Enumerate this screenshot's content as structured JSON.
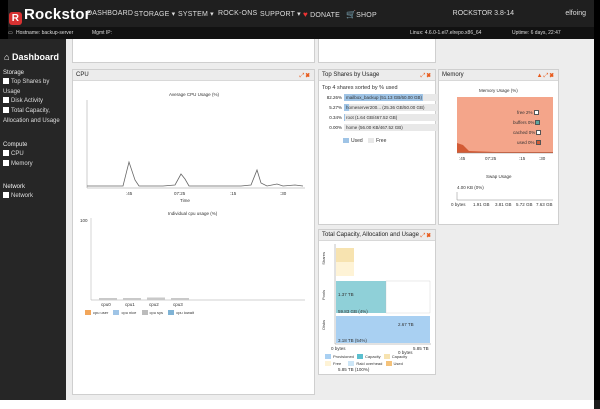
{
  "app": {
    "name": "Rockstor",
    "logo_letter": "R",
    "version": "ROCKSTOR 3.8-14",
    "user": "elfoing"
  },
  "nav": {
    "items": [
      "DASHBOARD",
      "STORAGE ▾",
      "SYSTEM ▾",
      "ROCK-ONS",
      "SUPPORT ▾"
    ],
    "donate": "DONATE",
    "shop": "SHOP"
  },
  "info": {
    "hostname": "Hostname: backup-server",
    "mgmt": "Mgmt IP:",
    "kernel": "Linux: 4.6.0-1.el7.elrepo.x86_64",
    "uptime": "Uptime: 6 days, 22:47"
  },
  "sidebar": {
    "title": "Dashboard",
    "groups": [
      {
        "heading": "Storage",
        "items": [
          "Top Shares by Usage",
          "Disk Activity",
          "Total Capacity, Allocation and Usage"
        ]
      },
      {
        "heading": "Compute",
        "items": [
          "CPU",
          "Memory"
        ]
      },
      {
        "heading": "Network",
        "items": [
          "Network"
        ]
      }
    ]
  },
  "cpu": {
    "title": "CPU",
    "avg_title": "Average CPU Usage (%)",
    "avg_ticks_x": [
      ":45",
      "07:25",
      ":15",
      ":30"
    ],
    "x_label": "Time",
    "indiv_title": "Individual cpu usage (%)",
    "indiv_y": "100",
    "indiv_x": [
      "cpu0",
      "cpu1",
      "cpu2",
      "cpu3"
    ],
    "legend": [
      "cpu user",
      "cpu nice",
      "cpu sys",
      "cpu iowait"
    ]
  },
  "shares": {
    "title": "Top Shares by Usage",
    "subtitle": "Top 4 shares sorted by % used",
    "rows": [
      {
        "pct": "82.26%",
        "label": "mailbox_backup (51.13 GB/60.00 GB)",
        "value": 0.8226
      },
      {
        "pct": "5.27%",
        "label": "homeserver200... (25.36 GB/50.00 GB)",
        "value": 0.0527
      },
      {
        "pct": "0.34%",
        "label": "root (1.64 GB/467.52 GB)",
        "value": 0.0034
      },
      {
        "pct": "0.00%",
        "label": "home (56.00 KB/467.52 GB)",
        "value": 0.0
      }
    ],
    "legend_used": "Used",
    "legend_free": "Free",
    "color_used": "#9fc4e6",
    "color_free": "#e8e8e8"
  },
  "memory": {
    "title": "Memory",
    "usage_title": "Memory Usage (%)",
    "legend": [
      "free 2%",
      "buffers 0%",
      "cached 0%",
      "used 0%"
    ],
    "time_ticks": [
      ":45",
      "07:25",
      ":15",
      ":30"
    ],
    "swap_title": "Swap Usage",
    "swap_value": "4.00 KB (0%)",
    "swap_ticks": [
      "0 bytes",
      "1.91 GB",
      "3.81 GB",
      "5.72 GB",
      "7.63 GB"
    ]
  },
  "capacity": {
    "title": "Total Capacity, Allocation and Usage",
    "shares_used": "1.37 TB",
    "shares_free": "59.83 GB (4%)",
    "pools_used": "3.18 TB (54%)",
    "pools_free": "2.67 TB",
    "disks_free": "0 bytes",
    "disks_used": "5.85 TB (100%)",
    "row_labels": [
      "Shares",
      "Pools",
      "Disks"
    ],
    "axis_ticks": [
      "0 bytes",
      "5.85 TB"
    ],
    "legend": [
      "Provisioned",
      "Capacity",
      "Capacity",
      "Free",
      "Raid overhead",
      "Used"
    ]
  }
}
